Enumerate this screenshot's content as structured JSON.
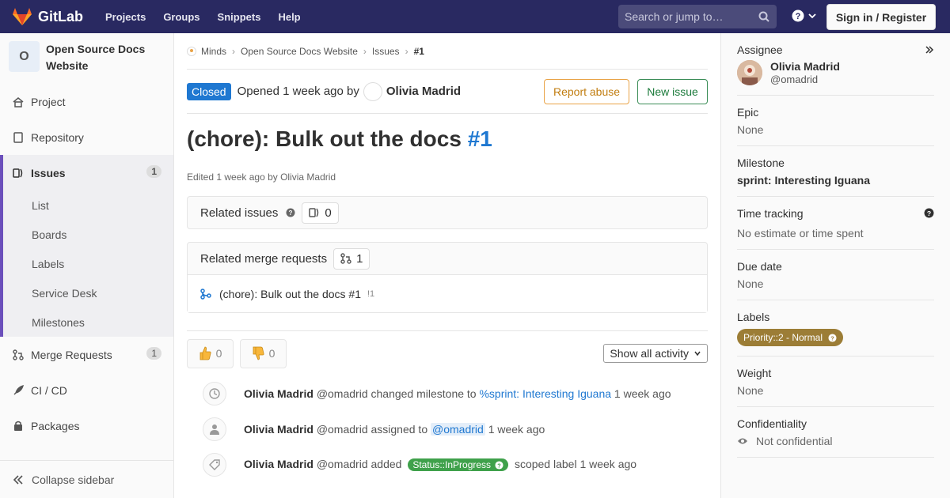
{
  "navbar": {
    "brand": "GitLab",
    "links": [
      "Projects",
      "Groups",
      "Snippets",
      "Help"
    ],
    "search_placeholder": "Search or jump to…",
    "signin": "Sign in / Register"
  },
  "sidebar": {
    "project_initial": "O",
    "project_name": "Open Source Docs Website",
    "items": [
      {
        "label": "Project"
      },
      {
        "label": "Repository"
      },
      {
        "label": "Issues",
        "count": "1"
      },
      {
        "label": "Merge Requests",
        "count": "1"
      },
      {
        "label": "CI / CD"
      },
      {
        "label": "Packages"
      }
    ],
    "issues_sub": [
      "List",
      "Boards",
      "Labels",
      "Service Desk",
      "Milestones"
    ],
    "collapse": "Collapse sidebar"
  },
  "breadcrumb": [
    "Minds",
    "Open Source Docs Website",
    "Issues",
    "#1"
  ],
  "issue": {
    "status": "Closed",
    "opened": "Opened 1 week ago by",
    "author": "Olivia Madrid",
    "report_abuse": "Report abuse",
    "new_issue": "New issue",
    "title": "(chore): Bulk out the docs",
    "number": "#1",
    "edited": "Edited 1 week ago by Olivia Madrid"
  },
  "related_issues": {
    "label": "Related issues",
    "count": "0"
  },
  "related_mrs": {
    "label": "Related merge requests",
    "count": "1",
    "items": [
      {
        "title": "(chore): Bulk out the docs #1",
        "ref": "!1"
      }
    ]
  },
  "reactions": {
    "thumbs_up": "0",
    "thumbs_down": "0",
    "show_all": "Show all activity"
  },
  "timeline": [
    {
      "author": "Olivia Madrid",
      "handle": "@omadrid",
      "action": "changed milestone to",
      "link": "%sprint: Interesting Iguana",
      "time": "1 week ago"
    },
    {
      "author": "Olivia Madrid",
      "handle": "@omadrid",
      "action": "assigned to",
      "link": "@omadrid",
      "time": "1 week ago"
    },
    {
      "author": "Olivia Madrid",
      "handle": "@omadrid",
      "action": "added",
      "label": "Status::InProgress",
      "after": "scoped label",
      "time": "1 week ago"
    }
  ],
  "right_sidebar": {
    "assignee_title": "Assignee",
    "assignee_name": "Olivia Madrid",
    "assignee_handle": "@omadrid",
    "epic_title": "Epic",
    "epic_value": "None",
    "milestone_title": "Milestone",
    "milestone_value": "sprint: Interesting Iguana",
    "time_title": "Time tracking",
    "time_value": "No estimate or time spent",
    "due_title": "Due date",
    "due_value": "None",
    "labels_title": "Labels",
    "label_value": "Priority::2 - Normal",
    "weight_title": "Weight",
    "weight_value": "None",
    "conf_title": "Confidentiality",
    "conf_value": "Not confidential"
  },
  "colors": {
    "navbar": "#292961",
    "closed": "#1f78d1",
    "accent": "#6b4fbb",
    "label_priority": "#9c7d36",
    "label_status": "#3fa14b"
  }
}
